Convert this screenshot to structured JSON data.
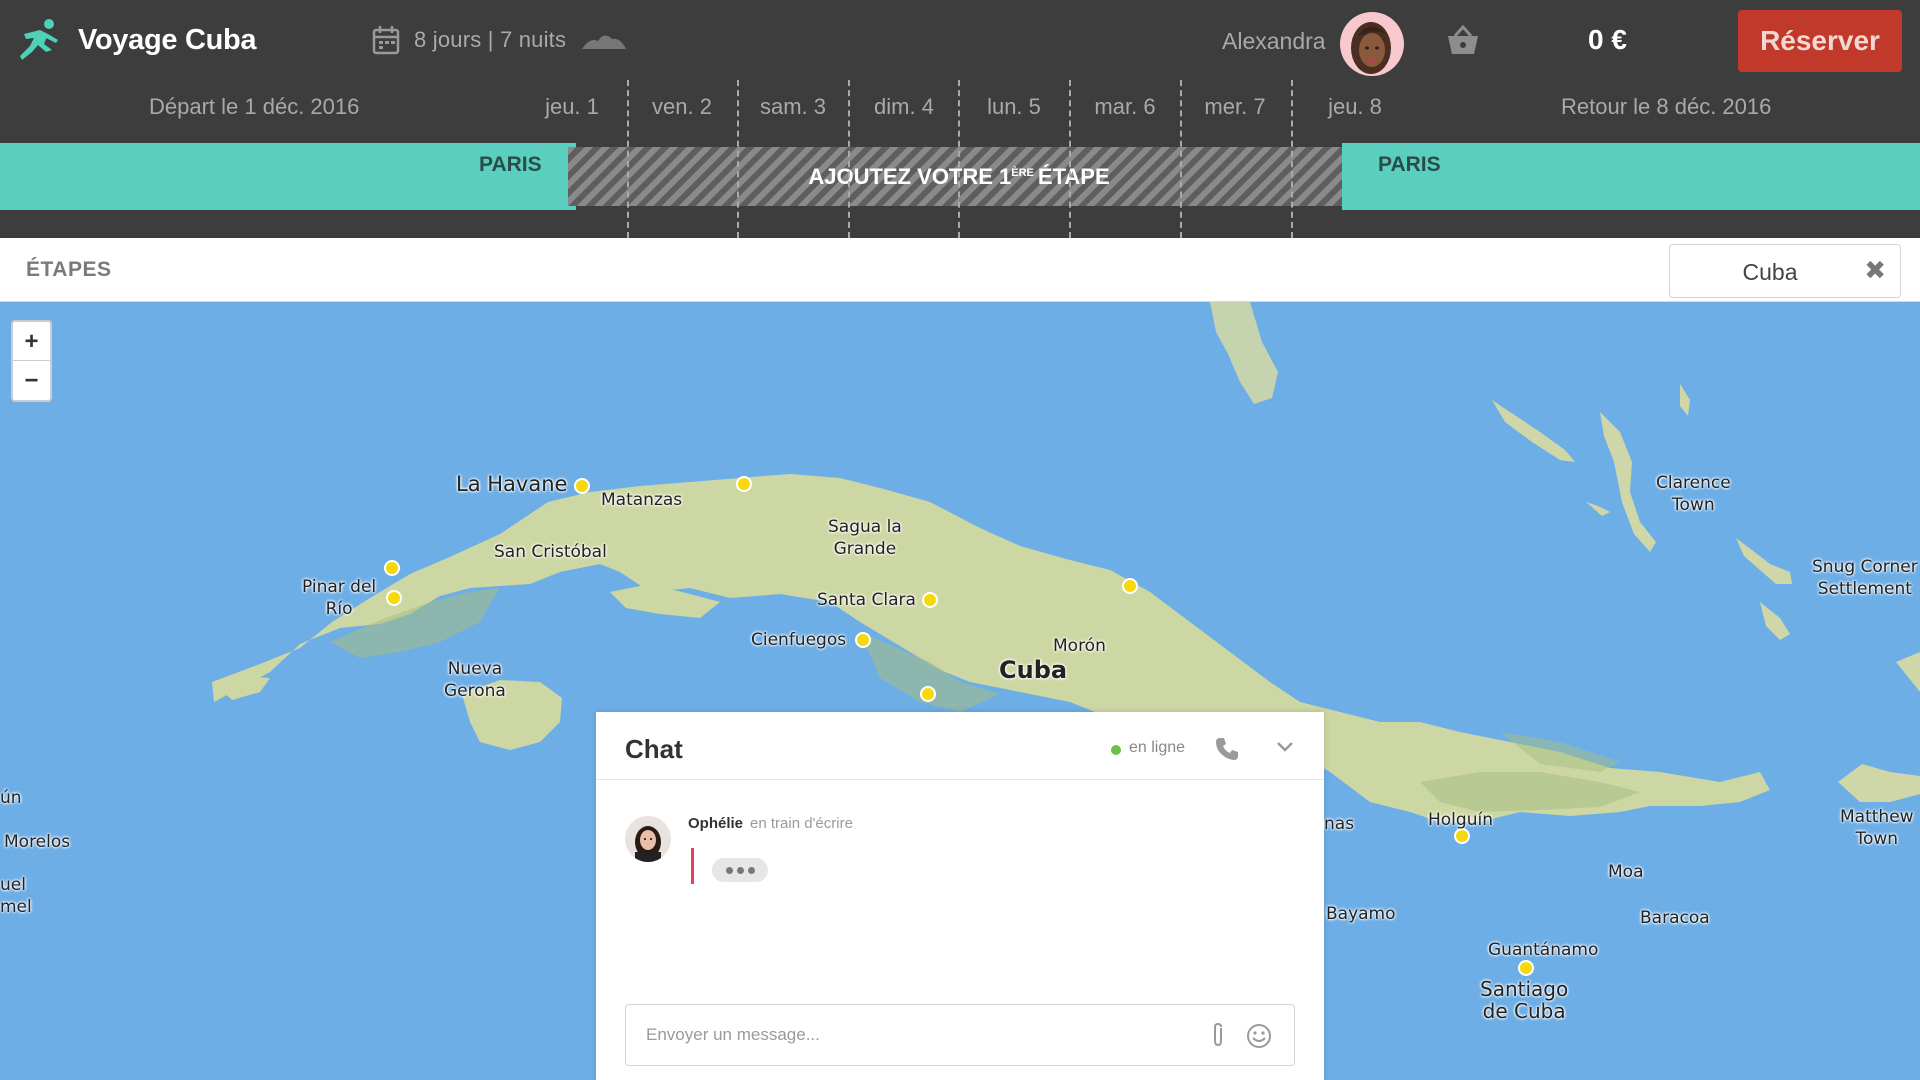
{
  "header": {
    "title": "Voyage Cuba",
    "duration": "8 jours | 7 nuits",
    "user_name": "Alexandra",
    "price": "0 €",
    "reserve_label": "Réserver"
  },
  "dates": {
    "departure": "Départ le 1 déc. 2016",
    "return": "Retour le 8 déc. 2016",
    "days": [
      "jeu. 1",
      "ven. 2",
      "sam. 3",
      "dim. 4",
      "lun. 5",
      "mar. 6",
      "mer. 7",
      "jeu. 8"
    ]
  },
  "timeline": {
    "start_city": "PARIS",
    "end_city": "PARIS",
    "add_step_prefix": "AJOUTEZ VOTRE 1",
    "add_step_sup": "ÈRE",
    "add_step_suffix": "ÉTAPE"
  },
  "section": {
    "title": "ÉTAPES",
    "filter_value": "Cuba",
    "clear_icon": "✖"
  },
  "map": {
    "zoom_in": "+",
    "zoom_out": "−",
    "labels": {
      "havana": "La Havane",
      "matanzas": "Matanzas",
      "sagua_1": "Sagua la",
      "sagua_2": "Grande",
      "san_cristobal": "San Cristóbal",
      "pinar_1": "Pinar del",
      "pinar_2": "Río",
      "santa_clara": "Santa Clara",
      "cienfuegos": "Cienfuegos",
      "moron": "Morón",
      "cuba": "Cuba",
      "nueva_1": "Nueva",
      "nueva_2": "Gerona",
      "clarence_1": "Clarence",
      "clarence_2": "Town",
      "snug_1": "Snug Corner",
      "snug_2": "Settlement",
      "matthew_1": "Matthew",
      "matthew_2": "Town",
      "holguin": "Holguín",
      "moa": "Moa",
      "bayamo": "Bayamo",
      "baracoa": "Baracoa",
      "guantanamo": "Guantánamo",
      "santiago_1": "Santiago",
      "santiago_2": "de Cuba",
      "tunas": "nas",
      "un": "ún",
      "morelos": "Morelos",
      "uel": "uel",
      "mel": "mel"
    }
  },
  "chat": {
    "title": "Chat",
    "status": "en ligne",
    "author": "Ophélie",
    "author_status": "en train d'écrire",
    "input_placeholder": "Envoyer un message..."
  },
  "colors": {
    "topbar": "#3d3d3d",
    "accent_teal": "#5bcfbf",
    "reserve_red": "#c0392b",
    "sea": "#6daee6",
    "pin_yellow": "#f7d80c"
  }
}
